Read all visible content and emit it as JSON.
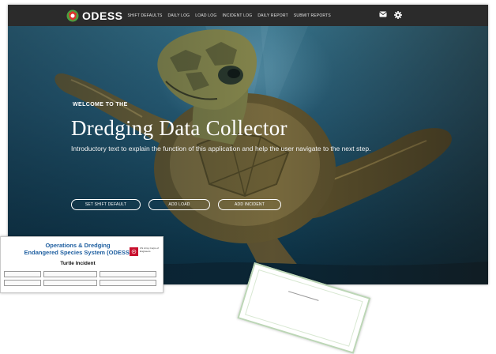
{
  "app": {
    "logo_text": "ODESS",
    "nav": [
      {
        "label": "Shift Defaults"
      },
      {
        "label": "Daily Log"
      },
      {
        "label": "Load Log"
      },
      {
        "label": "Incident Log"
      },
      {
        "label": "Daily Report"
      },
      {
        "label": "Submit Reports"
      }
    ],
    "icons": [
      "mail-icon",
      "gear-icon"
    ]
  },
  "hero": {
    "welcome": "WELCOME TO THE",
    "title": "Dredging Data Collector",
    "intro": "Introductory text to explain the function of this application and help the user navigate to the next step.",
    "buttons": [
      {
        "label": "Set Shift Default"
      },
      {
        "label": "Add Load"
      },
      {
        "label": "Add Incident"
      }
    ]
  },
  "form": {
    "title_line1": "Operations & Dredging",
    "title_line2": "Endangered Species System (ODESS)",
    "subtitle": "Turtle Incident",
    "agency": "US Army Corps of Engineers"
  },
  "colors": {
    "navbar": "#2b2b2b",
    "form_title": "#1f5fa0",
    "usace_red": "#c8102e"
  }
}
